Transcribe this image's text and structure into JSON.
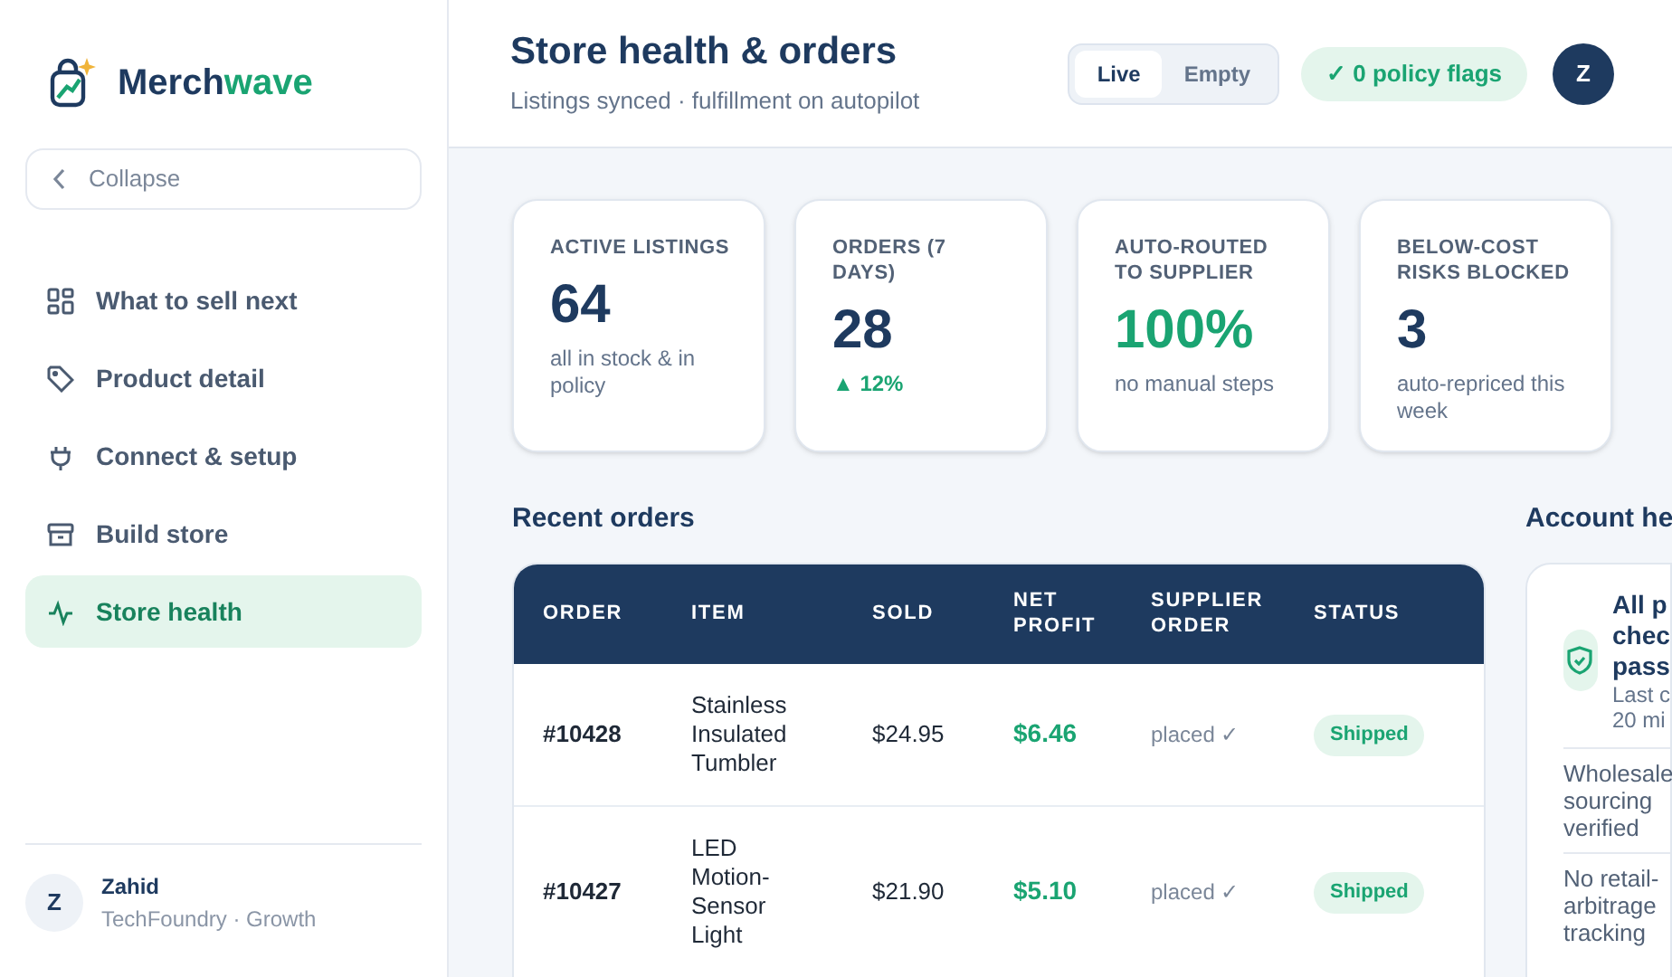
{
  "brand": {
    "name_start": "Merch",
    "name_end": "wave"
  },
  "collapse": {
    "label": "Collapse"
  },
  "nav": [
    {
      "label": "What to sell next",
      "kind": "grid",
      "selected": false
    },
    {
      "label": "Product detail",
      "kind": "tag",
      "selected": false
    },
    {
      "label": "Connect & setup",
      "kind": "plug",
      "selected": false
    },
    {
      "label": "Build store",
      "kind": "archive",
      "selected": false
    },
    {
      "label": "Store health",
      "kind": "pulse",
      "selected": true
    }
  ],
  "user": {
    "initial": "Z",
    "name": "Zahid",
    "org": "TechFoundry · Growth"
  },
  "header": {
    "title": "Store health & orders",
    "subtitle": "Listings synced · fulfillment on autopilot",
    "toggle": [
      {
        "label": "Live",
        "selected": true
      },
      {
        "label": "Empty",
        "selected": false
      }
    ],
    "flags": "✓ 0 policy flags",
    "avatar": "Z"
  },
  "stats": [
    {
      "label": "ACTIVE LISTINGS",
      "value": "64",
      "note": "all in stock & in policy",
      "kind": "plain"
    },
    {
      "label": "ORDERS (7 DAYS)",
      "value": "28",
      "note": "▲ 12%",
      "kind": "trend"
    },
    {
      "label": "AUTO-ROUTED TO SUPPLIER",
      "value": "100%",
      "note": "no manual steps",
      "kind": "success"
    },
    {
      "label": "BELOW-COST RISKS BLOCKED",
      "value": "3",
      "note": "auto-repriced this week",
      "kind": "plain"
    }
  ],
  "orders": {
    "title": "Recent orders",
    "columns": [
      "ORDER",
      "ITEM",
      "SOLD",
      "NET PROFIT",
      "SUPPLIER ORDER",
      "STATUS"
    ],
    "rows": [
      {
        "order": "#10428",
        "item": "Stainless Insulated Tumbler",
        "sold": "$24.95",
        "profit": "$6.46",
        "supplier": "placed ✓",
        "status": "Shipped"
      },
      {
        "order": "#10427",
        "item": "LED Motion-Sensor Light",
        "sold": "$21.90",
        "profit": "$5.10",
        "supplier": "placed ✓",
        "status": "Shipped"
      }
    ]
  },
  "account": {
    "title": "Account he",
    "check_title": "All p\nchec\npass",
    "check_note": "Last c\n20 mi",
    "items": [
      "Wholesale sourcing verified",
      "No retail-arbitrage tracking"
    ]
  }
}
